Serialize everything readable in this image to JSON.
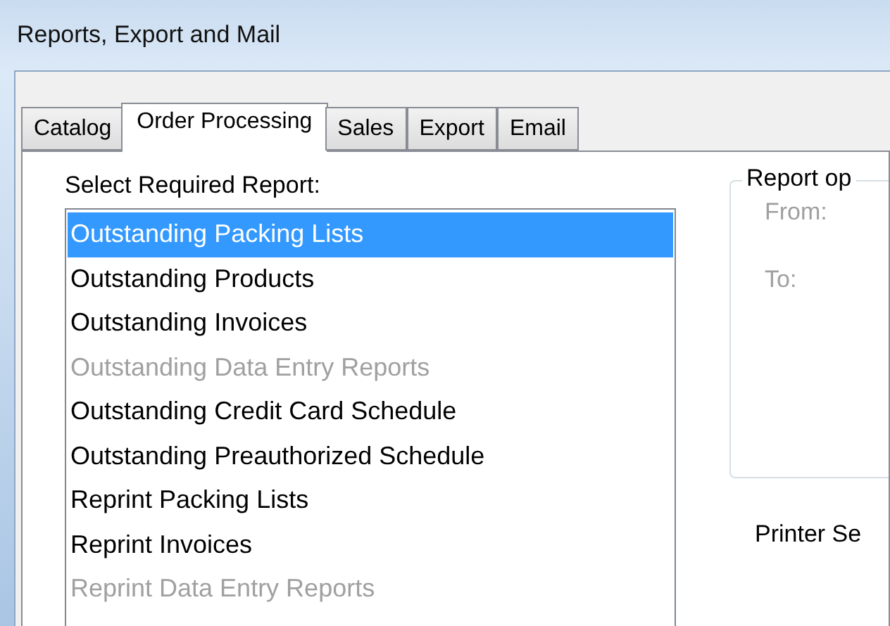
{
  "window": {
    "title": "Reports, Export and Mail"
  },
  "tabs": [
    {
      "label": "Catalog",
      "selected": false
    },
    {
      "label": "Order Processing",
      "selected": true
    },
    {
      "label": "Sales",
      "selected": false
    },
    {
      "label": "Export",
      "selected": false
    },
    {
      "label": "Email",
      "selected": false
    }
  ],
  "report_list": {
    "label": "Select Required Report:",
    "items": [
      {
        "label": "Outstanding Packing Lists",
        "selected": true,
        "disabled": false
      },
      {
        "label": "Outstanding Products",
        "selected": false,
        "disabled": false
      },
      {
        "label": "Outstanding Invoices",
        "selected": false,
        "disabled": false
      },
      {
        "label": "Outstanding Data Entry Reports",
        "selected": false,
        "disabled": true
      },
      {
        "label": "Outstanding Credit Card Schedule",
        "selected": false,
        "disabled": false
      },
      {
        "label": "Outstanding Preauthorized Schedule",
        "selected": false,
        "disabled": false
      },
      {
        "label": "Reprint Packing Lists",
        "selected": false,
        "disabled": false
      },
      {
        "label": "Reprint Invoices",
        "selected": false,
        "disabled": false
      },
      {
        "label": "Reprint Data Entry Reports",
        "selected": false,
        "disabled": true
      }
    ]
  },
  "report_options": {
    "title": "Report op",
    "fields": [
      {
        "label": "From:",
        "disabled": true
      },
      {
        "label": "To:",
        "disabled": true
      }
    ]
  },
  "printer_group": {
    "title": "Printer Se"
  }
}
